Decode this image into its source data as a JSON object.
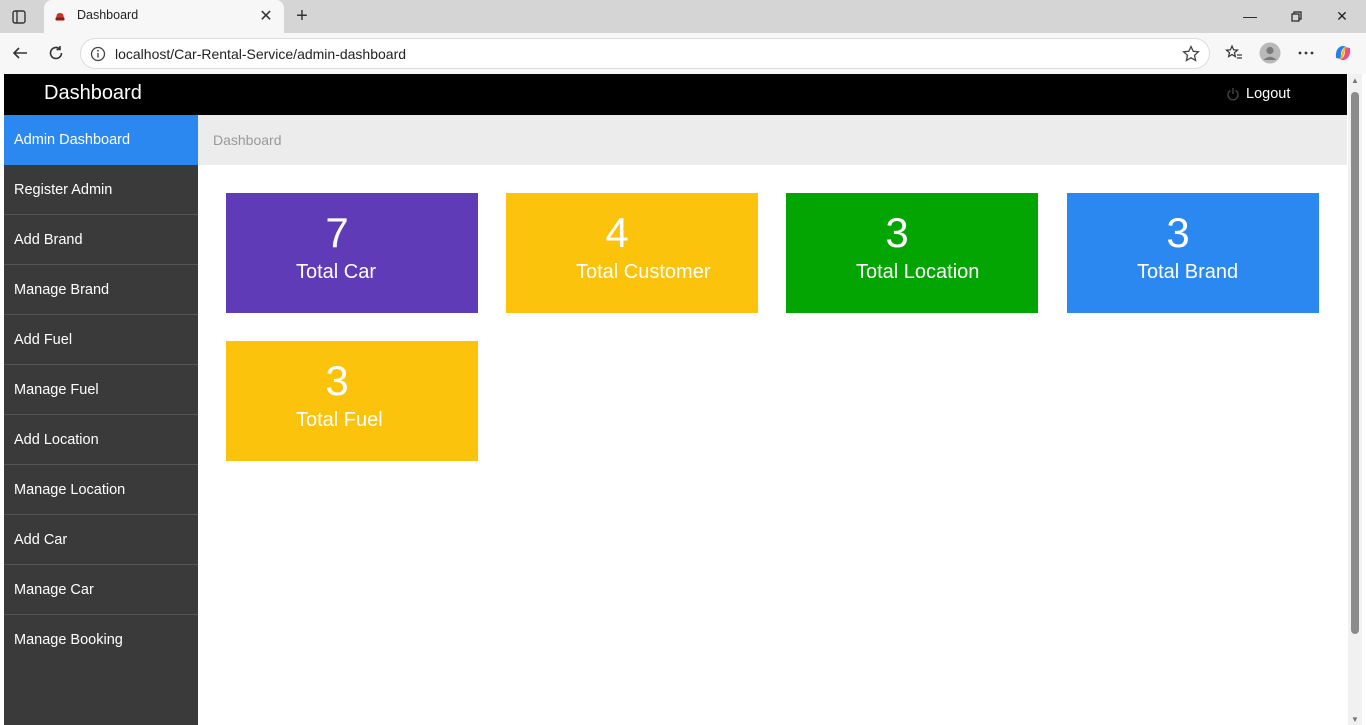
{
  "browser": {
    "tab_title": "Dashboard",
    "url": "localhost/Car-Rental-Service/admin-dashboard"
  },
  "page": {
    "brand": "Dashboard",
    "logout_label": "Logout",
    "breadcrumb": "Dashboard"
  },
  "sidebar": {
    "items": [
      {
        "label": "Admin Dashboard",
        "active": true
      },
      {
        "label": "Register Admin"
      },
      {
        "label": "Add Brand"
      },
      {
        "label": "Manage Brand"
      },
      {
        "label": "Add Fuel"
      },
      {
        "label": "Manage Fuel"
      },
      {
        "label": "Add Location"
      },
      {
        "label": "Manage Location"
      },
      {
        "label": "Add Car"
      },
      {
        "label": "Manage Car"
      },
      {
        "label": "Manage Booking"
      }
    ]
  },
  "cards": [
    {
      "count": "7",
      "label": "Total Car",
      "color": "#5f3bb7"
    },
    {
      "count": "4",
      "label": "Total Customer",
      "color": "#fbc30c"
    },
    {
      "count": "3",
      "label": "Total Location",
      "color": "#03a503"
    },
    {
      "count": "3",
      "label": "Total Brand",
      "color": "#2b88f0"
    },
    {
      "count": "3",
      "label": "Total Fuel",
      "color": "#fbc30c"
    }
  ],
  "colors": {
    "topbar": "#000000",
    "sidebar": "#3a3a3a",
    "sidebar_active": "#2b88f0"
  }
}
